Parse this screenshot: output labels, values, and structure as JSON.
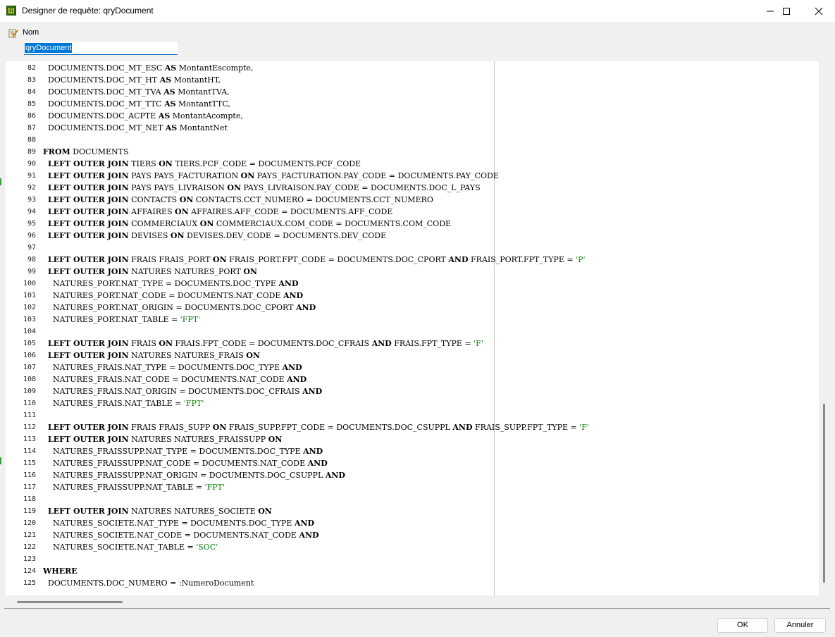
{
  "window": {
    "title": "Designer de requête: qryDocument",
    "buttons": [
      "minimize",
      "maximize",
      "close"
    ]
  },
  "form": {
    "name_label": "Nom",
    "name_value": "qryDocument"
  },
  "editor": {
    "lines": [
      {
        "n": "82",
        "t": [
          [
            "  DOCUMENTS.DOC_MT_ESC ",
            ""
          ],
          [
            "AS",
            ""
          ],
          [
            " MontantEscompte,",
            ""
          ]
        ]
      },
      {
        "n": "83",
        "t": [
          [
            "  DOCUMENTS.DOC_MT_HT ",
            ""
          ],
          [
            "AS",
            ""
          ],
          [
            " MontantHT,",
            ""
          ]
        ]
      },
      {
        "n": "84",
        "t": [
          [
            "  DOCUMENTS.DOC_MT_TVA ",
            ""
          ],
          [
            "AS",
            ""
          ],
          [
            " MontantTVA,",
            ""
          ]
        ]
      },
      {
        "n": "85",
        "t": [
          [
            "  DOCUMENTS.DOC_MT_TTC ",
            ""
          ],
          [
            "AS",
            ""
          ],
          [
            " MontantTTC,",
            ""
          ]
        ]
      },
      {
        "n": "86",
        "t": [
          [
            "  DOCUMENTS.DOC_ACPTE ",
            ""
          ],
          [
            "AS",
            ""
          ],
          [
            " MontantAcompte,",
            ""
          ]
        ]
      },
      {
        "n": "87",
        "t": [
          [
            "  DOCUMENTS.DOC_MT_NET ",
            ""
          ],
          [
            "AS",
            ""
          ],
          [
            " MontantNet",
            ""
          ]
        ]
      },
      {
        "n": "88",
        "t": []
      },
      {
        "n": "89",
        "t": [
          [
            "FROM",
            ""
          ],
          [
            " DOCUMENTS",
            ""
          ]
        ]
      },
      {
        "n": "90",
        "t": [
          [
            "  ",
            ""
          ],
          [
            "LEFT OUTER JOIN",
            ""
          ],
          [
            " TIERS ",
            ""
          ],
          [
            "ON",
            ""
          ],
          [
            " TIERS.PCF_CODE = DOCUMENTS.PCF_CODE",
            ""
          ]
        ]
      },
      {
        "n": "91",
        "t": [
          [
            "  ",
            ""
          ],
          [
            "LEFT OUTER JOIN",
            ""
          ],
          [
            " PAYS PAYS_FACTURATION ",
            ""
          ],
          [
            "ON",
            ""
          ],
          [
            " PAYS_FACTURATION.PAY_CODE = DOCUMENTS.PAY_CODE",
            ""
          ]
        ]
      },
      {
        "n": "92",
        "t": [
          [
            "  ",
            ""
          ],
          [
            "LEFT OUTER JOIN",
            ""
          ],
          [
            " PAYS PAYS_LIVRAISON ",
            ""
          ],
          [
            "ON",
            ""
          ],
          [
            " PAYS_LIVRAISON.PAY_CODE = DOCUMENTS.DOC_L_PAYS",
            ""
          ]
        ]
      },
      {
        "n": "93",
        "t": [
          [
            "  ",
            ""
          ],
          [
            "LEFT OUTER JOIN",
            ""
          ],
          [
            " CONTACTS ",
            ""
          ],
          [
            "ON",
            ""
          ],
          [
            " CONTACTS.CCT_NUMERO = DOCUMENTS.CCT_NUMERO",
            ""
          ]
        ]
      },
      {
        "n": "94",
        "t": [
          [
            "  ",
            ""
          ],
          [
            "LEFT OUTER JOIN",
            ""
          ],
          [
            " AFFAIRES ",
            ""
          ],
          [
            "ON",
            ""
          ],
          [
            " AFFAIRES.AFF_CODE = DOCUMENTS.AFF_CODE",
            ""
          ]
        ]
      },
      {
        "n": "95",
        "t": [
          [
            "  ",
            ""
          ],
          [
            "LEFT OUTER JOIN",
            ""
          ],
          [
            " COMMERCIAUX ",
            ""
          ],
          [
            "ON",
            ""
          ],
          [
            " COMMERCIAUX.COM_CODE = DOCUMENTS.COM_CODE",
            ""
          ]
        ]
      },
      {
        "n": "96",
        "t": [
          [
            "  ",
            ""
          ],
          [
            "LEFT OUTER JOIN",
            ""
          ],
          [
            " DEVISES ",
            ""
          ],
          [
            "ON",
            ""
          ],
          [
            " DEVISES.DEV_CODE = DOCUMENTS.DEV_CODE",
            ""
          ]
        ]
      },
      {
        "n": "97",
        "t": []
      },
      {
        "n": "98",
        "t": [
          [
            "  ",
            ""
          ],
          [
            "LEFT OUTER JOIN",
            ""
          ],
          [
            " FRAIS FRAIS_PORT ",
            ""
          ],
          [
            "ON",
            ""
          ],
          [
            " FRAIS_PORT.FPT_CODE = DOCUMENTS.DOC_CPORT ",
            ""
          ],
          [
            "AND",
            ""
          ],
          [
            " FRAIS_PORT.FPT_TYPE = ",
            ""
          ],
          [
            "'P'",
            ""
          ]
        ]
      },
      {
        "n": "99",
        "t": [
          [
            "  ",
            ""
          ],
          [
            "LEFT OUTER JOIN",
            ""
          ],
          [
            " NATURES NATURES_PORT ",
            ""
          ],
          [
            "ON",
            ""
          ]
        ]
      },
      {
        "n": "100",
        "t": [
          [
            "    NATURES_PORT.NAT_TYPE = DOCUMENTS.DOC_TYPE ",
            ""
          ],
          [
            "AND",
            ""
          ]
        ]
      },
      {
        "n": "101",
        "t": [
          [
            "    NATURES_PORT.NAT_CODE = DOCUMENTS.NAT_CODE ",
            ""
          ],
          [
            "AND",
            ""
          ]
        ]
      },
      {
        "n": "102",
        "t": [
          [
            "    NATURES_PORT.NAT_ORIGIN = DOCUMENTS.DOC_CPORT ",
            ""
          ],
          [
            "AND",
            ""
          ]
        ]
      },
      {
        "n": "103",
        "t": [
          [
            "    NATURES_PORT.NAT_TABLE = ",
            ""
          ],
          [
            "'FPT'",
            ""
          ]
        ]
      },
      {
        "n": "104",
        "t": []
      },
      {
        "n": "105",
        "t": [
          [
            "  ",
            ""
          ],
          [
            "LEFT OUTER JOIN",
            ""
          ],
          [
            " FRAIS ",
            ""
          ],
          [
            "ON",
            ""
          ],
          [
            " FRAIS.FPT_CODE = DOCUMENTS.DOC_CFRAIS ",
            ""
          ],
          [
            "AND",
            ""
          ],
          [
            " FRAIS.FPT_TYPE = ",
            ""
          ],
          [
            "'F'",
            ""
          ]
        ]
      },
      {
        "n": "106",
        "t": [
          [
            "  ",
            ""
          ],
          [
            "LEFT OUTER JOIN",
            ""
          ],
          [
            " NATURES NATURES_FRAIS ",
            ""
          ],
          [
            "ON",
            ""
          ]
        ]
      },
      {
        "n": "107",
        "t": [
          [
            "    NATURES_FRAIS.NAT_TYPE = DOCUMENTS.DOC_TYPE ",
            ""
          ],
          [
            "AND",
            ""
          ]
        ]
      },
      {
        "n": "108",
        "t": [
          [
            "    NATURES_FRAIS.NAT_CODE = DOCUMENTS.NAT_CODE ",
            ""
          ],
          [
            "AND",
            ""
          ]
        ]
      },
      {
        "n": "109",
        "t": [
          [
            "    NATURES_FRAIS.NAT_ORIGIN = DOCUMENTS.DOC_CFRAIS ",
            ""
          ],
          [
            "AND",
            ""
          ]
        ]
      },
      {
        "n": "110",
        "t": [
          [
            "    NATURES_FRAIS.NAT_TABLE = ",
            ""
          ],
          [
            "'FPT'",
            ""
          ]
        ]
      },
      {
        "n": "111",
        "t": []
      },
      {
        "n": "112",
        "t": [
          [
            "  ",
            ""
          ],
          [
            "LEFT OUTER JOIN",
            ""
          ],
          [
            " FRAIS FRAIS_SUPP ",
            ""
          ],
          [
            "ON",
            ""
          ],
          [
            " FRAIS_SUPP.FPT_CODE = DOCUMENTS.DOC_CSUPPL ",
            ""
          ],
          [
            "AND",
            ""
          ],
          [
            " FRAIS_SUPP.FPT_TYPE = ",
            ""
          ],
          [
            "'F'",
            ""
          ]
        ]
      },
      {
        "n": "113",
        "t": [
          [
            "  ",
            ""
          ],
          [
            "LEFT OUTER JOIN",
            ""
          ],
          [
            " NATURES NATURES_FRAISSUPP ",
            ""
          ],
          [
            "ON",
            ""
          ]
        ]
      },
      {
        "n": "114",
        "t": [
          [
            "    NATURES_FRAISSUPP.NAT_TYPE = DOCUMENTS.DOC_TYPE ",
            ""
          ],
          [
            "AND",
            ""
          ]
        ]
      },
      {
        "n": "115",
        "t": [
          [
            "    NATURES_FRAISSUPP.NAT_CODE = DOCUMENTS.NAT_CODE ",
            ""
          ],
          [
            "AND",
            ""
          ]
        ]
      },
      {
        "n": "116",
        "t": [
          [
            "    NATURES_FRAISSUPP.NAT_ORIGIN = DOCUMENTS.DOC_CSUPPL ",
            ""
          ],
          [
            "AND",
            ""
          ]
        ]
      },
      {
        "n": "117",
        "t": [
          [
            "    NATURES_FRAISSUPP.NAT_TABLE = ",
            ""
          ],
          [
            "'FPT'",
            ""
          ]
        ]
      },
      {
        "n": "118",
        "t": []
      },
      {
        "n": "119",
        "t": [
          [
            "  ",
            ""
          ],
          [
            "LEFT OUTER JOIN",
            ""
          ],
          [
            " NATURES NATURES_SOCIETE ",
            ""
          ],
          [
            "ON",
            ""
          ]
        ]
      },
      {
        "n": "120",
        "t": [
          [
            "    NATURES_SOCIETE.NAT_TYPE = DOCUMENTS.DOC_TYPE ",
            ""
          ],
          [
            "AND",
            ""
          ]
        ]
      },
      {
        "n": "121",
        "t": [
          [
            "    NATURES_SOCIETE.NAT_CODE = DOCUMENTS.NAT_CODE ",
            ""
          ],
          [
            "AND",
            ""
          ]
        ]
      },
      {
        "n": "122",
        "t": [
          [
            "    NATURES_SOCIETE.NAT_TABLE = ",
            ""
          ],
          [
            "'SOC'",
            ""
          ]
        ]
      },
      {
        "n": "123",
        "t": []
      },
      {
        "n": "124",
        "t": [
          [
            "WHERE",
            ""
          ]
        ]
      },
      {
        "n": "125",
        "t": [
          [
            "  DOCUMENTS.DOC_NUMERO = :NumeroDocument",
            ""
          ]
        ]
      }
    ]
  },
  "footer": {
    "ok_label": "OK",
    "cancel_label": "Annuler"
  },
  "colors": {
    "keyword": "#000000",
    "string": "#128212",
    "selection": "#0078d7"
  }
}
